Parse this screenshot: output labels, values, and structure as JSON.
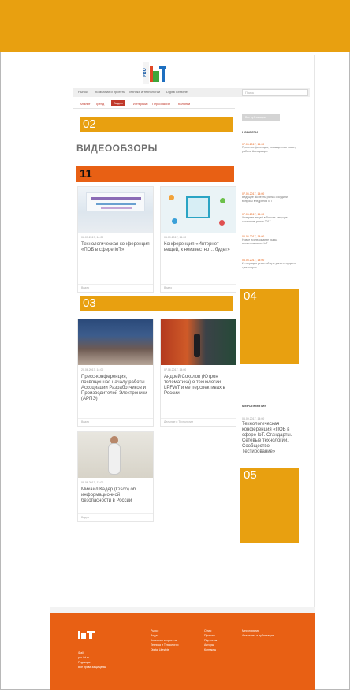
{
  "header": {
    "logo_text": "PRO IoT"
  },
  "nav_primary": [
    "Рынок",
    "Компании и проекты",
    "Техника и технологии",
    "Digital Lifestyle"
  ],
  "search": {
    "placeholder": "Поиск"
  },
  "nav_secondary": [
    "Аналит",
    "Тренд",
    "Видео",
    "Интервью",
    "Персоналии",
    "Колонки"
  ],
  "nav_secondary_active": "Видео",
  "markers": {
    "m02": "02",
    "m11": "11",
    "m03": "03",
    "m04": "04",
    "m05": "05"
  },
  "page_title": "ВИДЕООБЗОРЫ",
  "cards": [
    {
      "date": "06.09.2017, 14:00",
      "title": "Технологическая конференция «ПОБ в сфере IoT»",
      "foot": "Видео"
    },
    {
      "date": "06.09.2017, 14:00",
      "title": "Конференция «Интернет вещей, к неизвестно… будет»",
      "foot": "Видео"
    },
    {
      "date": "20.06.2017, 14:00",
      "title": "Пресс-конференция, посвященная началу работы Ассоциации Разработчиков и Производителей Электроники (АРПЭ)",
      "foot": "Видео"
    },
    {
      "date": "07.06.2017, 14:00",
      "title": "Андрей Соколов (Ютрон телематика) о технологии LPFWT и ее перспективах в России",
      "foot": "Дельные и Технологии"
    },
    {
      "date": "08.06.2017, 12:00",
      "title": "Михаил Кадер (Cisco) об информационной безопасности в России",
      "foot": "Видео"
    }
  ],
  "sidebar": {
    "button": "Все публикации",
    "news_heading": "НОВОСТИ",
    "news": [
      {
        "date": "07.06.2017, 14:00",
        "title": "Пресс-конференция, посвященная началу работы Ассоциации"
      },
      {
        "date": "07.06.2017, 14:00",
        "title": "Ведущие эксперты рынка обсудили вопросы внедрения IoT"
      },
      {
        "date": "07.06.2017, 14:00",
        "title": "Интернет вещей в России: текущее состояние рынка 2017"
      },
      {
        "date": "06.06.2017, 14:00",
        "title": "Новое исследование рынка промышленного IoT"
      },
      {
        "date": "06.06.2017, 14:00",
        "title": "Интеграция решений для умного города и транспорта"
      }
    ],
    "partners_heading": "МЕРОПРИЯТИЯ",
    "event_date": "06.09.2017, 14:00",
    "event_title": "Технологическая конференция «ПОБ в сфере IoT. Стандарты. Сетевые технологии. Сообщество. Тестирование»"
  },
  "footer": {
    "col1": [
      "iDall",
      "pro-iot.ru",
      "Редакция",
      "Все права защищены"
    ],
    "col2": [
      "Рынок",
      "Видео",
      "Компании и проекты",
      "Техника и Технологии",
      "Digital Lifestyle"
    ],
    "col3": [
      "О нас",
      "Проекты",
      "Партнеры",
      "Авторы",
      "Контакты"
    ],
    "col4": [
      "Мероприятия",
      "Аналитика и публикации"
    ]
  }
}
